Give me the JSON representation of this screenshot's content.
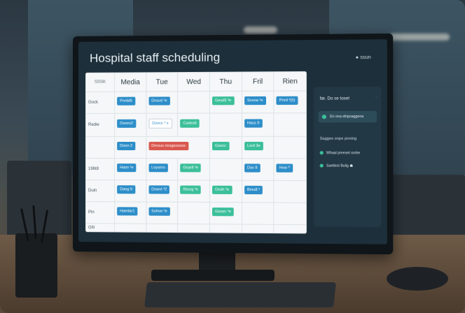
{
  "app": {
    "title": "Hospital staff scheduling",
    "top_indicator": "● ssun"
  },
  "schedule": {
    "corner_label": "SSSK",
    "days": [
      "Media",
      "Tue",
      "Wed",
      "Thu",
      "Fril",
      "Rien"
    ],
    "rows": [
      {
        "label": "Gock",
        "cells": [
          {
            "text": "Pnrdd5",
            "color": "blue"
          },
          {
            "text": "Dnsvd ³e",
            "color": "blue"
          },
          null,
          {
            "text": "Gesd5 ³e",
            "color": "green"
          },
          {
            "text": "Sosoa ³e",
            "color": "blue"
          },
          {
            "text": "Pnrd ³(5)",
            "color": "blue"
          }
        ]
      },
      {
        "label": "Redie",
        "cells": [
          {
            "text": "Dsees2",
            "color": "blue"
          },
          {
            "text": "Dsocs ³ s",
            "color": "outline"
          },
          {
            "text": "Cades6",
            "color": "green"
          },
          null,
          {
            "text": "Hass 9",
            "color": "blue"
          },
          null
        ]
      },
      {
        "label": "",
        "cells": [
          {
            "text": "Doon 2",
            "color": "blue"
          },
          {
            "text": "Dnrsus nnsgssosos",
            "color": "red",
            "span": 2
          },
          {
            "text": "Gsocc",
            "color": "green"
          },
          {
            "text": "Lsrd 3e",
            "color": "green"
          },
          null
        ]
      },
      {
        "label": "196t8",
        "cells": [
          {
            "text": "Hasn ³e",
            "color": "blue"
          },
          {
            "text": "Loysmo",
            "color": "blue"
          },
          {
            "text": "Gsarlt ³e",
            "color": "green"
          },
          null,
          {
            "text": "Dav 8",
            "color": "blue"
          },
          {
            "text": "Hvw ³'",
            "color": "blue"
          }
        ]
      },
      {
        "label": "Duin",
        "cells": [
          {
            "text": "Dang 9",
            "color": "blue"
          },
          {
            "text": "Dowvt ³2",
            "color": "blue"
          },
          {
            "text": "Resrg ³e",
            "color": "green"
          },
          {
            "text": "Orsih ³e",
            "color": "green"
          },
          {
            "text": "Bmu8 ³",
            "color": "blue"
          },
          null
        ]
      },
      {
        "label": "Pin",
        "cells": [
          {
            "text": "Haedar1",
            "color": "blue"
          },
          {
            "text": "Sohon ³e",
            "color": "blue"
          },
          null,
          {
            "text": "Gsosn ³e",
            "color": "green"
          },
          null,
          null
        ]
      },
      {
        "label": "Gfii",
        "cells": [
          null,
          null,
          null,
          null,
          null,
          null
        ]
      }
    ]
  },
  "panel": {
    "title": "fæ. Do se toset",
    "close": "·",
    "pill_text": "En ona elnpsaggena",
    "subtitle": "Sagges onpe pnning",
    "items": [
      "Whaal preeset oorke",
      "Saetlest Bulig ☗"
    ]
  },
  "icons": {
    "pill": "status-dot-icon",
    "item": "bullet-dot-icon"
  },
  "colors": {
    "blue": "#2d8ec9",
    "green": "#3bbf9a",
    "red": "#d9584e",
    "panel": "#223845"
  }
}
